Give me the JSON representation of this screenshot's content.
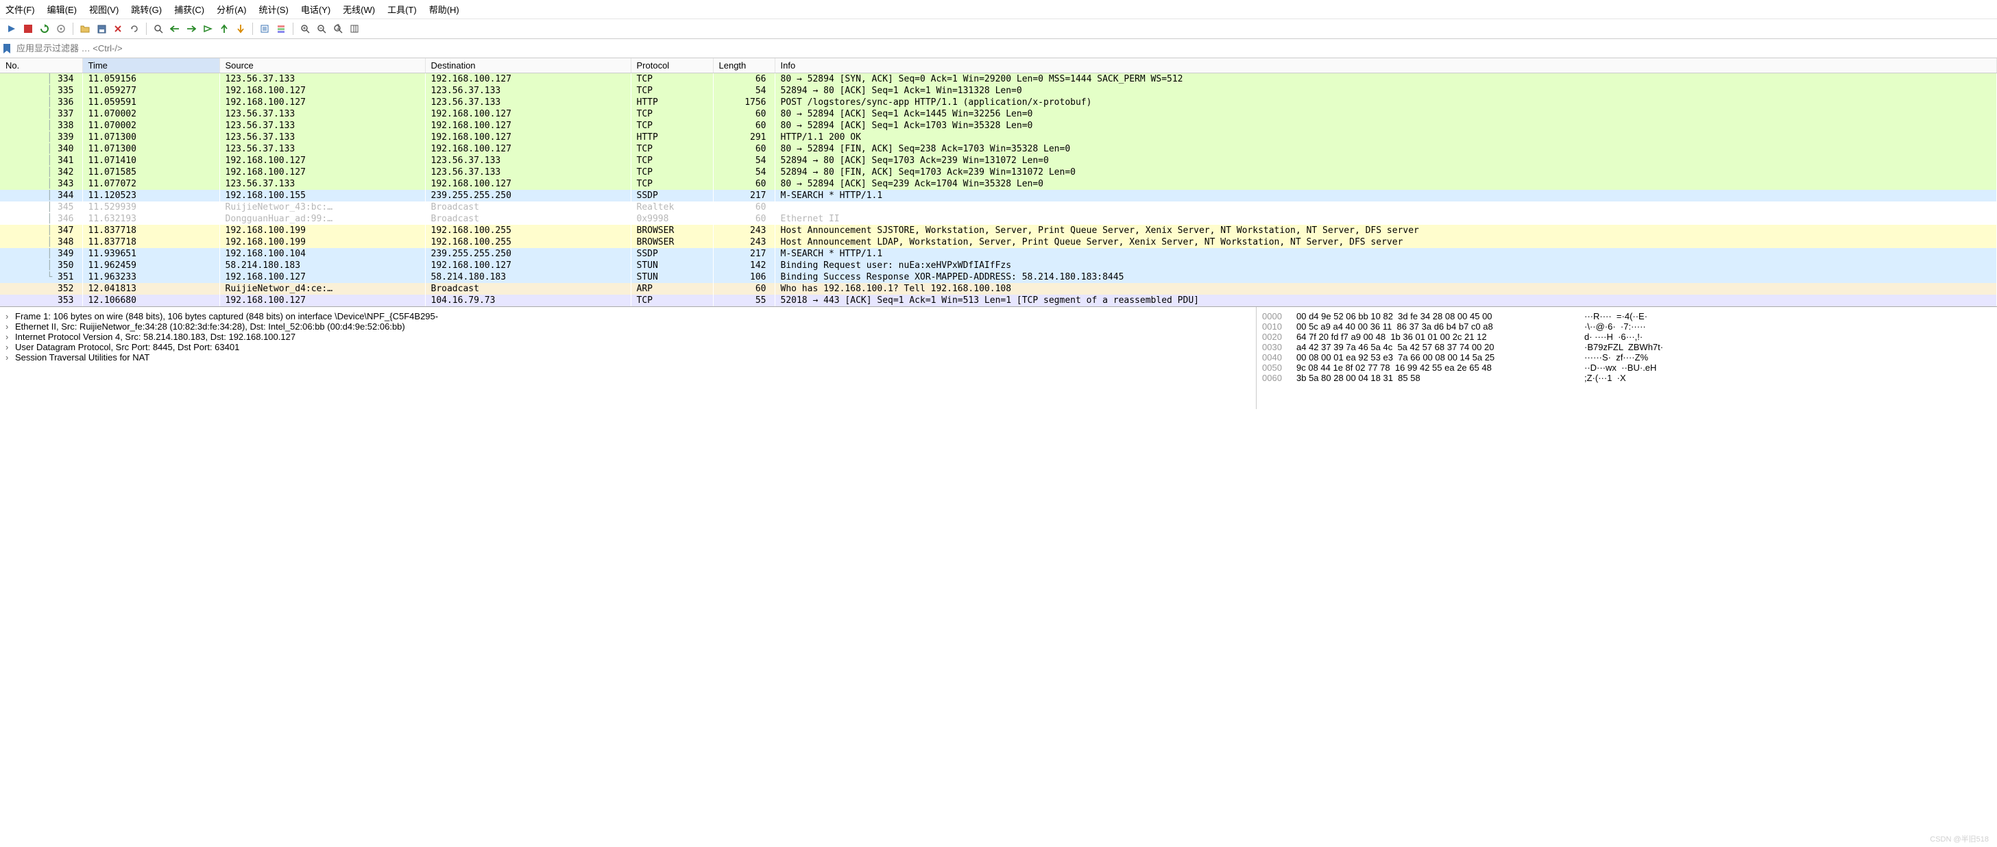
{
  "menubar": [
    "文件(F)",
    "编辑(E)",
    "视图(V)",
    "跳转(G)",
    "捕获(C)",
    "分析(A)",
    "统计(S)",
    "电话(Y)",
    "无线(W)",
    "工具(T)",
    "帮助(H)"
  ],
  "filter": {
    "placeholder": "应用显示过滤器 … <Ctrl-/>"
  },
  "columns": {
    "no": "No.",
    "time": "Time",
    "source": "Source",
    "dest": "Destination",
    "proto": "Protocol",
    "len": "Length",
    "info": "Info"
  },
  "packets": [
    {
      "no": 334,
      "time": "11.059156",
      "src": "123.56.37.133",
      "dst": "192.168.100.127",
      "proto": "TCP",
      "len": 66,
      "info": "80 → 52894 [SYN, ACK] Seq=0 Ack=1 Win=29200 Len=0 MSS=1444 SACK_PERM WS=512",
      "cls": "c-green",
      "mark": "│"
    },
    {
      "no": 335,
      "time": "11.059277",
      "src": "192.168.100.127",
      "dst": "123.56.37.133",
      "proto": "TCP",
      "len": 54,
      "info": "52894 → 80 [ACK] Seq=1 Ack=1 Win=131328 Len=0",
      "cls": "c-green",
      "mark": "│"
    },
    {
      "no": 336,
      "time": "11.059591",
      "src": "192.168.100.127",
      "dst": "123.56.37.133",
      "proto": "HTTP",
      "len": 1756,
      "info": "POST /logstores/sync-app HTTP/1.1  (application/x-protobuf)",
      "cls": "c-green",
      "mark": "│"
    },
    {
      "no": 337,
      "time": "11.070002",
      "src": "123.56.37.133",
      "dst": "192.168.100.127",
      "proto": "TCP",
      "len": 60,
      "info": "80 → 52894 [ACK] Seq=1 Ack=1445 Win=32256 Len=0",
      "cls": "c-green",
      "mark": "│"
    },
    {
      "no": 338,
      "time": "11.070002",
      "src": "123.56.37.133",
      "dst": "192.168.100.127",
      "proto": "TCP",
      "len": 60,
      "info": "80 → 52894 [ACK] Seq=1 Ack=1703 Win=35328 Len=0",
      "cls": "c-green",
      "mark": "│"
    },
    {
      "no": 339,
      "time": "11.071300",
      "src": "123.56.37.133",
      "dst": "192.168.100.127",
      "proto": "HTTP",
      "len": 291,
      "info": "HTTP/1.1 200 OK",
      "cls": "c-green",
      "mark": "│"
    },
    {
      "no": 340,
      "time": "11.071300",
      "src": "123.56.37.133",
      "dst": "192.168.100.127",
      "proto": "TCP",
      "len": 60,
      "info": "80 → 52894 [FIN, ACK] Seq=238 Ack=1703 Win=35328 Len=0",
      "cls": "c-green",
      "mark": "│"
    },
    {
      "no": 341,
      "time": "11.071410",
      "src": "192.168.100.127",
      "dst": "123.56.37.133",
      "proto": "TCP",
      "len": 54,
      "info": "52894 → 80 [ACK] Seq=1703 Ack=239 Win=131072 Len=0",
      "cls": "c-green",
      "mark": "│"
    },
    {
      "no": 342,
      "time": "11.071585",
      "src": "192.168.100.127",
      "dst": "123.56.37.133",
      "proto": "TCP",
      "len": 54,
      "info": "52894 → 80 [FIN, ACK] Seq=1703 Ack=239 Win=131072 Len=0",
      "cls": "c-green",
      "mark": "│"
    },
    {
      "no": 343,
      "time": "11.077072",
      "src": "123.56.37.133",
      "dst": "192.168.100.127",
      "proto": "TCP",
      "len": 60,
      "info": "80 → 52894 [ACK] Seq=239 Ack=1704 Win=35328 Len=0",
      "cls": "c-green",
      "mark": "│"
    },
    {
      "no": 344,
      "time": "11.120523",
      "src": "192.168.100.155",
      "dst": "239.255.255.250",
      "proto": "SSDP",
      "len": 217,
      "info": "M-SEARCH * HTTP/1.1",
      "cls": "c-blue",
      "mark": "│"
    },
    {
      "no": 345,
      "time": "11.529939",
      "src": "RuijieNetwor_43:bc:…",
      "dst": "Broadcast",
      "proto": "Realtek",
      "len": 60,
      "info": "",
      "cls": "c-gray",
      "mark": "│"
    },
    {
      "no": 346,
      "time": "11.632193",
      "src": "DongguanHuar_ad:99:…",
      "dst": "Broadcast",
      "proto": "0x9998",
      "len": 60,
      "info": "Ethernet II",
      "cls": "c-gray",
      "mark": "│"
    },
    {
      "no": 347,
      "time": "11.837718",
      "src": "192.168.100.199",
      "dst": "192.168.100.255",
      "proto": "BROWSER",
      "len": 243,
      "info": "Host Announcement SJSTORE, Workstation, Server, Print Queue Server, Xenix Server, NT Workstation, NT Server, DFS server",
      "cls": "c-yellow",
      "mark": "│"
    },
    {
      "no": 348,
      "time": "11.837718",
      "src": "192.168.100.199",
      "dst": "192.168.100.255",
      "proto": "BROWSER",
      "len": 243,
      "info": "Host Announcement LDAP, Workstation, Server, Print Queue Server, Xenix Server, NT Workstation, NT Server, DFS server",
      "cls": "c-yellow",
      "mark": "│"
    },
    {
      "no": 349,
      "time": "11.939651",
      "src": "192.168.100.104",
      "dst": "239.255.255.250",
      "proto": "SSDP",
      "len": 217,
      "info": "M-SEARCH * HTTP/1.1",
      "cls": "c-blue",
      "mark": "│"
    },
    {
      "no": 350,
      "time": "11.962459",
      "src": "58.214.180.183",
      "dst": "192.168.100.127",
      "proto": "STUN",
      "len": 142,
      "info": "Binding Request user: nuEa:xeHVPxWDfIAIfFzs",
      "cls": "c-blue",
      "mark": "│"
    },
    {
      "no": 351,
      "time": "11.963233",
      "src": "192.168.100.127",
      "dst": "58.214.180.183",
      "proto": "STUN",
      "len": 106,
      "info": "Binding Success Response XOR-MAPPED-ADDRESS: 58.214.180.183:8445",
      "cls": "c-blue",
      "mark": "└"
    },
    {
      "no": 352,
      "time": "12.041813",
      "src": "RuijieNetwor_d4:ce:…",
      "dst": "Broadcast",
      "proto": "ARP",
      "len": 60,
      "info": "Who has 192.168.100.1? Tell 192.168.100.108",
      "cls": "c-tan",
      "mark": ""
    },
    {
      "no": 353,
      "time": "12.106680",
      "src": "192.168.100.127",
      "dst": "104.16.79.73",
      "proto": "TCP",
      "len": 55,
      "info": "52018 → 443 [ACK] Seq=1 Ack=1 Win=513 Len=1 [TCP segment of a reassembled PDU]",
      "cls": "c-lav",
      "mark": ""
    }
  ],
  "tree": [
    "Frame 1: 106 bytes on wire (848 bits), 106 bytes captured (848 bits) on interface \\Device\\NPF_{C5F4B295-",
    "Ethernet II, Src: RuijieNetwor_fe:34:28 (10:82:3d:fe:34:28), Dst: Intel_52:06:bb (00:d4:9e:52:06:bb)",
    "Internet Protocol Version 4, Src: 58.214.180.183, Dst: 192.168.100.127",
    "User Datagram Protocol, Src Port: 8445, Dst Port: 63401",
    "Session Traversal Utilities for NAT"
  ],
  "hex": [
    {
      "off": "0000",
      "b": "00 d4 9e 52 06 bb 10 82  3d fe 34 28 08 00 45 00",
      "a": "···R····  =·4(··E·"
    },
    {
      "off": "0010",
      "b": "00 5c a9 a4 40 00 36 11  86 37 3a d6 b4 b7 c0 a8",
      "a": "·\\··@·6·  ·7:·····"
    },
    {
      "off": "0020",
      "b": "64 7f 20 fd f7 a9 00 48  1b 36 01 01 00 2c 21 12",
      "a": "d· ····H  ·6···,!·"
    },
    {
      "off": "0030",
      "b": "a4 42 37 39 7a 46 5a 4c  5a 42 57 68 37 74 00 20",
      "a": "·B79zFZL  ZBWh7t· "
    },
    {
      "off": "0040",
      "b": "00 08 00 01 ea 92 53 e3  7a 66 00 08 00 14 5a 25",
      "a": "······S·  zf····Z%"
    },
    {
      "off": "0050",
      "b": "9c 08 44 1e 8f 02 77 78  16 99 42 55 ea 2e 65 48",
      "a": "··D···wx  ··BU·.eH"
    },
    {
      "off": "0060",
      "b": "3b 5a 80 28 00 04 18 31  85 58",
      "a": ";Z·(···1  ·X"
    }
  ],
  "watermark": "CSDN @半旧518"
}
